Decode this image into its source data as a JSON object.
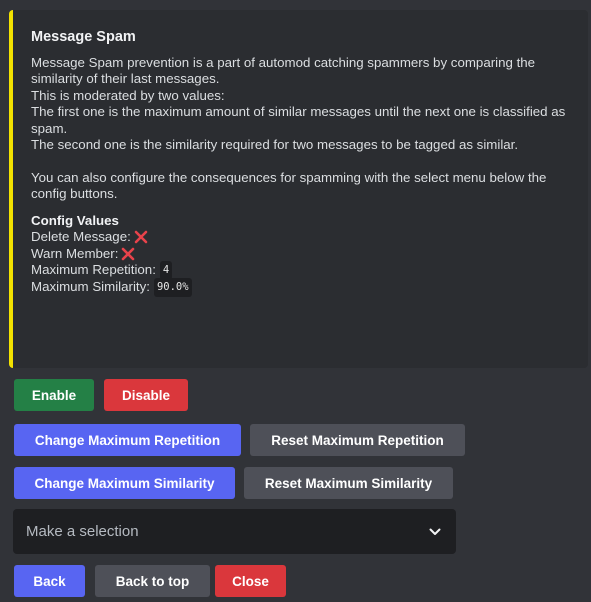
{
  "embed": {
    "accent_color": "#f3e200",
    "title": "Message Spam",
    "description_lines": [
      "Message Spam prevention is a part of automod catching spammers by comparing the similarity of their last messages.",
      "This is moderated by two values:",
      "The first one is the maximum amount of similar messages until the next one is classified as spam.",
      "The second one is the similarity required for two messages to be tagged as similar.",
      "",
      "You can also configure the consequences for spamming with the select menu below the config buttons."
    ],
    "config": {
      "heading": "Config Values",
      "delete_message_label": "Delete Message:",
      "delete_message_icon": "red-x-icon",
      "warn_member_label": "Warn Member:",
      "warn_member_icon": "red-x-icon",
      "max_repetition_label": "Maximum Repetition:",
      "max_repetition_value": "4",
      "max_similarity_label": "Maximum Similarity:",
      "max_similarity_value": "90.0%"
    }
  },
  "buttons": {
    "enable": "Enable",
    "disable": "Disable",
    "change_max_repetition": "Change Maximum Repetition",
    "reset_max_repetition": "Reset Maximum Repetition",
    "change_max_similarity": "Change Maximum Similarity",
    "reset_max_similarity": "Reset Maximum Similarity",
    "back": "Back",
    "back_to_top": "Back to top",
    "close": "Close"
  },
  "select": {
    "placeholder": "Make a selection"
  },
  "colors": {
    "green": "#248046",
    "red": "#da373c",
    "blurple": "#5865f2",
    "grey": "#4e5058",
    "background": "#313338",
    "embed_background": "#2b2d31"
  }
}
